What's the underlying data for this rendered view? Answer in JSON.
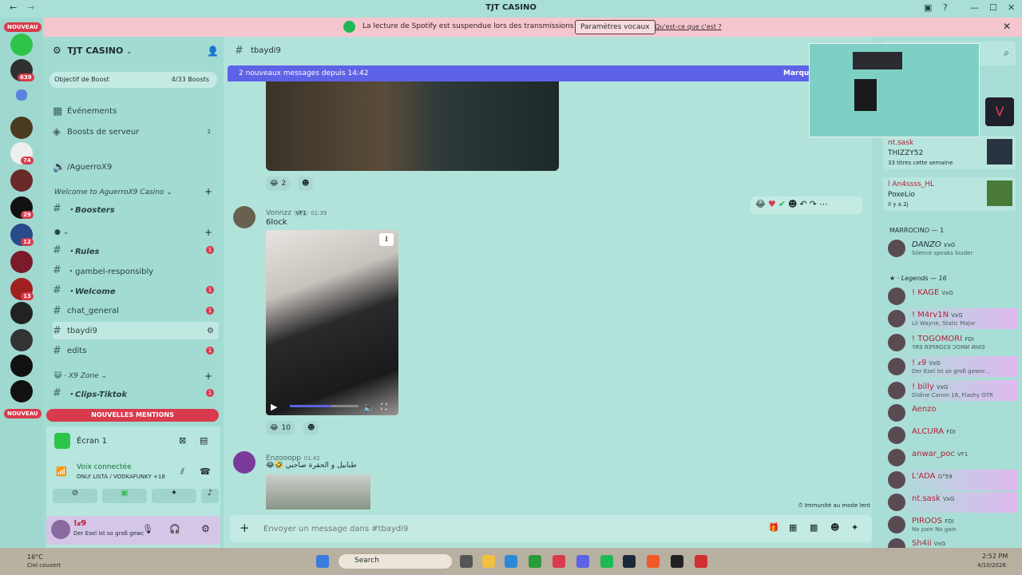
{
  "window": {
    "title": "TJT CASINO"
  },
  "colors": {
    "accent": "#5d62e6",
    "danger": "#d83b4d",
    "bg": "#a9ded6"
  },
  "rail": {
    "new_label": "NOUVEAU",
    "badges": [
      "639",
      "74",
      "29",
      "12",
      "13"
    ]
  },
  "spotify_bar": {
    "message": "La lecture de Spotify est suspendue lors des transmissions audio.",
    "button": "Paramètres vocaux",
    "link": "Qu'est-ce que c'est ?"
  },
  "server": {
    "name": "TJT CASINO",
    "boost_goal": "Objectif de Boost",
    "boost_count": "4/33 Boosts",
    "events": "Événements",
    "boosts": "Boosts de serveur",
    "boosts_count": "2",
    "voice_room": "/AguerroX9"
  },
  "categories": {
    "welcome": "Welcome to AguerroX9 Casino",
    "x9zone": "X9 Zone",
    "blank": ""
  },
  "channels": [
    {
      "name": "・Boosters",
      "unread": ""
    },
    {
      "name": "・Rules",
      "unread": "1"
    },
    {
      "name": "・gambel-responsibly",
      "unread": ""
    },
    {
      "name": "・Welcome",
      "unread": "1"
    },
    {
      "name": "chat_general",
      "unread": "1"
    },
    {
      "name": "tbaydi9",
      "unread": ""
    },
    {
      "name": "edits",
      "unread": "1"
    },
    {
      "name": "・Clips-Tiktok",
      "unread": "1"
    }
  ],
  "mentions_bar": "NOUVELLES MENTIONS",
  "screen_share": {
    "label": "Écran 1"
  },
  "voice": {
    "status": "Voix connectée",
    "channel": "ONLY LISTA / VODKAFUNKY +18"
  },
  "user_panel": {
    "name": "!𝓍9",
    "status": "Der Esel ist so groß gewc"
  },
  "chat": {
    "channel": "tbaydi9",
    "new_messages": "2 nouveaux messages depuis 14:42",
    "mark_read": "Marque",
    "messages": [
      {
        "author": "Vonnzz",
        "tag": "VF1",
        "time": "01:39",
        "text": "6lock",
        "reaction_count": "10"
      },
      {
        "author": "Enzooopp",
        "tag": "",
        "time": "01:42",
        "text": "😂🤣 طبابيل و الحقرة صاحبي",
        "reaction_count": ""
      }
    ],
    "first_reaction_count": "2",
    "slow_mode": "Immunité au mode lent",
    "input_placeholder": "Envoyer un message dans #tbaydi9"
  },
  "members": {
    "activity": [
      {
        "name": "nt.sask",
        "title": "THIZZY52",
        "sub": "33 titres cette semaine"
      },
      {
        "name": "l An4ssss_HL",
        "title": "PoxeLio",
        "sub": "Il y a 2j"
      }
    ],
    "group1": "MARROCINO — 1",
    "group1_members": [
      {
        "name": "DANZO",
        "tag": "VxG",
        "status": "Silence speaks louder"
      }
    ],
    "group2": "Legends — 16",
    "group2_members": [
      {
        "name": "! KAGE",
        "tag": "VxG",
        "status": ""
      },
      {
        "name": "! M4rv1N",
        "tag": "VxG",
        "status": "Lil Wayne, Static Major"
      },
      {
        "name": "! TOGOMORI",
        "tag": "FDI",
        "status": "ꟻЯƎ ЯƎꟼЯOƧƎ ƆOMИ ИIИƎ"
      },
      {
        "name": "! 𝓍9",
        "tag": "VxG",
        "status": "Der Esel ist so groß gewor..."
      },
      {
        "name": "! billy",
        "tag": "VxG",
        "status": "Didine Canon 16, Flashy OTR"
      },
      {
        "name": "Aenzo",
        "tag": "",
        "status": ""
      },
      {
        "name": "ALCURA",
        "tag": "FDI",
        "status": ""
      },
      {
        "name": "anwar_poc",
        "tag": "VF1",
        "status": ""
      },
      {
        "name": "L'ADA",
        "tag": "G°59",
        "status": ""
      },
      {
        "name": "nt.sask",
        "tag": "VxG",
        "status": ""
      },
      {
        "name": "PIROOS",
        "tag": "FDI",
        "status": "No pain No gain"
      },
      {
        "name": "Sh4ii",
        "tag": "VxG",
        "status": ""
      }
    ]
  },
  "taskbar": {
    "weather_temp": "16°C",
    "weather_desc": "Ciel couvert",
    "search": "Search",
    "time": "2:52 PM",
    "date": "4/10/2026"
  }
}
